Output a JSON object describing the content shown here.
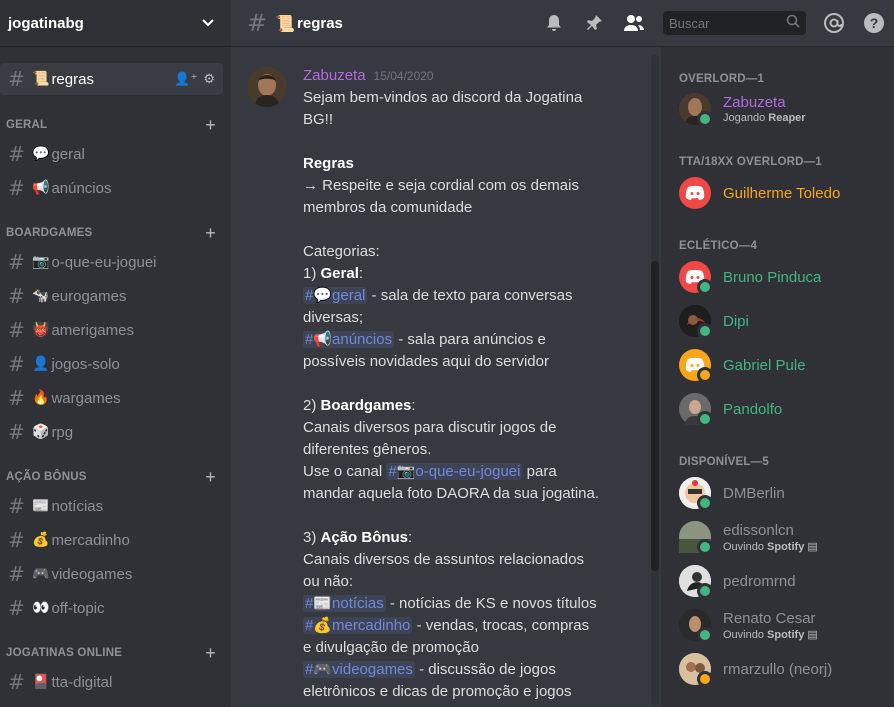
{
  "guild": {
    "name": "jogatinabg"
  },
  "sidebar": {
    "active_channel": {
      "emoji": "📜",
      "label": "regras"
    },
    "categories": [
      {
        "name": "GERAL",
        "channels": [
          {
            "emoji": "💬",
            "label": "geral"
          },
          {
            "emoji": "📢",
            "label": "anúncios"
          }
        ]
      },
      {
        "name": "BOARDGAMES",
        "channels": [
          {
            "emoji": "📷",
            "label": "o-que-eu-joguei"
          },
          {
            "emoji": "🐄",
            "label": "eurogames"
          },
          {
            "emoji": "👹",
            "label": "amerigames"
          },
          {
            "emoji": "👤",
            "label": "jogos-solo"
          },
          {
            "emoji": "🔥",
            "label": "wargames"
          },
          {
            "emoji": "🎲",
            "label": "rpg"
          }
        ]
      },
      {
        "name": "AÇÃO BÔNUS",
        "channels": [
          {
            "emoji": "📰",
            "label": "notícias"
          },
          {
            "emoji": "💰",
            "label": "mercadinho"
          },
          {
            "emoji": "🎮",
            "label": "videogames"
          },
          {
            "emoji": "👀",
            "label": "off-topic"
          }
        ]
      },
      {
        "name": "JOGATINAS ONLINE",
        "channels": [
          {
            "emoji": "🎴",
            "label": "tta-digital"
          }
        ]
      }
    ]
  },
  "topbar": {
    "channel_emoji": "📜",
    "channel_name": "regras",
    "search_placeholder": "Buscar"
  },
  "message": {
    "author": "Zabuzeta",
    "timestamp": "15/04/2020",
    "lines": {
      "l1": "Sejam bem-vindos ao discord da Jogatina",
      "l2": "BG!!",
      "l4": "Regras",
      "l5": "→ Respeite e seja cordial com os demais",
      "l6": "membros da comunidade",
      "l8": "Categorias:",
      "l9a": "1) ",
      "l9b": "Geral",
      "l9c": ":",
      "l10_mention": "💬geral",
      "l10_rest": " - sala de texto para conversas",
      "l11": "diversas;",
      "l12_mention": "📢anúncios",
      "l12_rest": " - sala para anúncios e",
      "l13": "possíveis novidades aqui do servidor",
      "l15a": "2) ",
      "l15b": "Boardgames",
      "l15c": ":",
      "l16": "Canais diversos para discutir jogos de",
      "l17": "diferentes gêneros.",
      "l18_pre": "Use o canal ",
      "l18_mention": "📷o-que-eu-joguei",
      "l18_rest": " para",
      "l19": "mandar aquela foto DAORA da sua jogatina.",
      "l21a": "3) ",
      "l21b": "Ação Bônus",
      "l21c": ":",
      "l22": "Canais diversos de assuntos relacionados",
      "l23": "ou não:",
      "l24_mention": "📰notícias",
      "l24_rest": " - notícias de KS e novos títulos",
      "l25_mention": "💰mercadinho",
      "l25_rest": " - vendas, trocas, compras",
      "l26": "e divulgação de promoção",
      "l27_mention": "🎮videogames",
      "l27_rest": " - discussão de jogos",
      "l28": "eletrônicos e dicas de promoção e jogos"
    }
  },
  "members": {
    "roles": [
      {
        "name": "OVERLORD—1"
      },
      {
        "name": "TTA/18XX OVERLORD—1"
      },
      {
        "name": "ECLÉTICO—4"
      },
      {
        "name": "DISPONÍVEL—5"
      }
    ],
    "list": [
      {
        "name": "Zabuzeta",
        "sub_pre": "Jogando ",
        "sub_bold": "Reaper"
      },
      {
        "name": "Guilherme Toledo"
      },
      {
        "name": "Bruno Pinduca"
      },
      {
        "name": "Dipi"
      },
      {
        "name": "Gabriel Pule"
      },
      {
        "name": "Pandolfo"
      },
      {
        "name": "DMBerlin"
      },
      {
        "name": "edissonlcn",
        "sub_pre": "Ouvindo ",
        "sub_bold": "Spotify"
      },
      {
        "name": "pedromrnd"
      },
      {
        "name": "Renato Cesar",
        "sub_pre": "Ouvindo ",
        "sub_bold": "Spotify"
      },
      {
        "name": "rmarzullo (neorj)"
      }
    ]
  },
  "colors": {
    "online": "#43b581",
    "idle": "#faa61a",
    "author": "#b36be0",
    "eclético": "#43b581",
    "tta": "#faa61a",
    "mention": "#7289da"
  }
}
